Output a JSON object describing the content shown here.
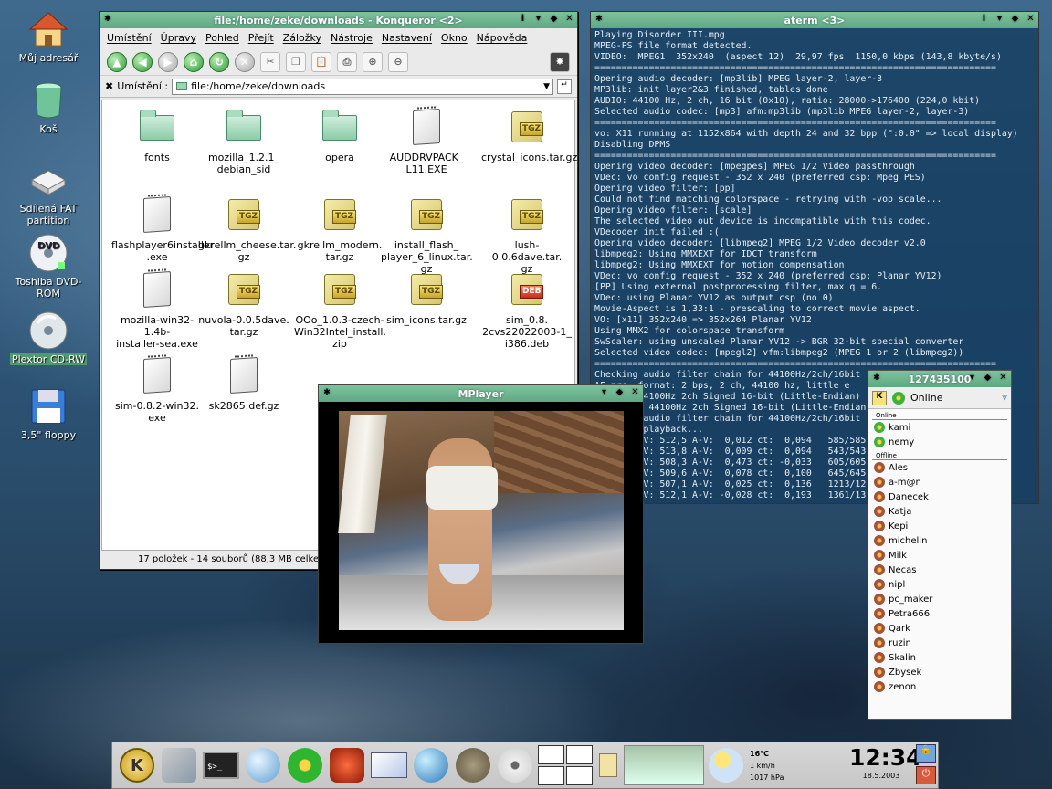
{
  "desktop": {
    "icons": [
      {
        "label": "Můj adresář",
        "icon": "home-icon"
      },
      {
        "label": "Koš",
        "icon": "trash-icon"
      },
      {
        "label": "Sdílená FAT partition",
        "icon": "drive-icon"
      },
      {
        "label": "Toshiba DVD-ROM",
        "icon": "dvd-icon"
      },
      {
        "label": "Plextor CD-RW",
        "icon": "cdrw-icon"
      },
      {
        "label": "3,5\" floppy",
        "icon": "floppy-icon"
      }
    ]
  },
  "konqueror": {
    "title": "file:/home/zeke/downloads - Konqueror <2>",
    "menu": [
      "Umístění",
      "Úpravy",
      "Pohled",
      "Přejít",
      "Záložky",
      "Nástroje",
      "Nastavení",
      "Okno",
      "Nápověda"
    ],
    "location_label": "Umístění :",
    "location_value": "file:/home/zeke/downloads",
    "files": [
      {
        "name": "fonts",
        "type": "folder"
      },
      {
        "name": "mozilla_1.2.1_ debian_sid",
        "type": "folder"
      },
      {
        "name": "opera",
        "type": "folder"
      },
      {
        "name": "AUDDRVPACK_ L11.EXE",
        "type": "file"
      },
      {
        "name": "crystal_icons.tar.gz",
        "type": "tgz"
      },
      {
        "name": "flashplayer6installer .exe",
        "type": "file"
      },
      {
        "name": "gkrellm_cheese.tar. gz",
        "type": "tgz"
      },
      {
        "name": "gkrellm_modern. tar.gz",
        "type": "tgz"
      },
      {
        "name": "install_flash_ player_6_linux.tar. gz",
        "type": "tgz"
      },
      {
        "name": "lush-0.0.6dave.tar. gz",
        "type": "tgz"
      },
      {
        "name": "mozilla-win32-1.4b- installer-sea.exe",
        "type": "file"
      },
      {
        "name": "nuvola-0.0.5dave. tar.gz",
        "type": "tgz"
      },
      {
        "name": "OOo_1.0.3-czech- Win32Intel_install. zip",
        "type": "tgz"
      },
      {
        "name": "sim_icons.tar.gz",
        "type": "tgz"
      },
      {
        "name": "sim_0.8. 2cvs22022003-1_ i386.deb",
        "type": "deb"
      },
      {
        "name": "sim-0.8.2-win32. exe",
        "type": "file"
      },
      {
        "name": "sk2865.def.gz",
        "type": "file"
      }
    ],
    "status": "17 položek - 14 souborů (88,3 MB celken"
  },
  "aterm": {
    "title": "aterm <3>",
    "lines": [
      "Playing Disorder III.mpg",
      "MPEG-PS file format detected.",
      "VIDEO:  MPEG1  352x240  (aspect 12)  29,97 fps  1150,0 kbps (143,8 kbyte/s)",
      "==========================================================================",
      "Opening audio decoder: [mp3lib] MPEG layer-2, layer-3",
      "MP3lib: init layer2&3 finished, tables done",
      "AUDIO: 44100 Hz, 2 ch, 16 bit (0x10), ratio: 28000->176400 (224,0 kbit)",
      "Selected audio codec: [mp3] afm:mp3lib (mp3lib MPEG layer-2, layer-3)",
      "==========================================================================",
      "vo: X11 running at 1152x864 with depth 24 and 32 bpp (\":0.0\" => local display)",
      "Disabling DPMS",
      "==========================================================================",
      "Opening video decoder: [mpegpes] MPEG 1/2 Video passthrough",
      "VDec: vo config request - 352 x 240 (preferred csp: Mpeg PES)",
      "Opening video filter: [pp]",
      "Could not find matching colorspace - retrying with -vop scale...",
      "Opening video filter: [scale]",
      "The selected video_out device is incompatible with this codec.",
      "VDecoder init failed :(",
      "Opening video decoder: [libmpeg2] MPEG 1/2 Video decoder v2.0",
      "libmpeg2: Using MMXEXT for IDCT transform",
      "libmpeg2: Using MMXEXT for motion compensation",
      "VDec: vo config request - 352 x 240 (preferred csp: Planar YV12)",
      "[PP] Using external postprocessing filter, max q = 6.",
      "VDec: using Planar YV12 as output csp (no 0)",
      "Movie-Aspect is 1,33:1 - prescaling to correct movie aspect.",
      "VO: [x11] 352x240 => 352x264 Planar YV12",
      "Using MMX2 for colorspace transform",
      "SwScaler: using unscaled Planar YV12 -> BGR 32-bit special converter",
      "Selected video codec: [mpegl2] vfm:libmpeg2 (MPEG 1 or 2 (libmpeg2))",
      "==========================================================================",
      "Checking audio filter chain for 44100Hz/2ch/16bit",
      "AF_pre: format: 2 bps, 2 ch, 44100 hz, little e",
      "AF_pre: 44100Hz 2ch Signed 16-bit (Little-Endian)",
      "AO: [oss] 44100Hz 2ch Signed 16-bit (Little-Endian",
      "Building audio filter chain for 44100Hz/2ch/16bit",
      "Starting playback...",
      "A: 512,5 V: 512,5 A-V:  0,012 ct:  0,094   585/585",
      "A: 513,8 V: 513,8 A-V:  0,009 ct:  0,094   543/543",
      "A: 508,3 V: 508,3 A-V:  0,473 ct: -0,033   605/605",
      "A: 509,6 V: 509,6 A-V:  0,078 ct:  0,100   645/645",
      "A: 507,1 V: 507,1 A-V:  0,025 ct:  0,136   1213/12",
      "A: 512,1 V: 512,1 A-V: -0,028 ct:  0,193   1361/13"
    ]
  },
  "mplayer": {
    "title": "MPlayer"
  },
  "buddy": {
    "title": "127435100",
    "status": "Online",
    "online_label": "Online",
    "offline_label": "Offline",
    "online": [
      "kami",
      "nemy"
    ],
    "offline": [
      "Ales",
      "a-m@n",
      "Danecek",
      "Katja",
      "Kepi",
      "michelin",
      "Milk",
      "Necas",
      "nipl",
      "pc_maker",
      "Petra666",
      "Qark",
      "ruzin",
      "Skalin",
      "Zbysek",
      "zenon"
    ]
  },
  "taskbar": {
    "icons": [
      "kde-menu-icon",
      "control-center-icon",
      "konsole-icon",
      "konqueror-icon",
      "icq-icon",
      "kde-dragon-icon",
      "mail-icon",
      "browser-globe-icon",
      "gimp-icon",
      "cd-player-icon"
    ],
    "weather": {
      "temp": "16°C",
      "wind": "1 km/h",
      "pressure": "1017 hPa"
    },
    "clock": {
      "time": "12:34",
      "date": "18.5.2003"
    }
  }
}
